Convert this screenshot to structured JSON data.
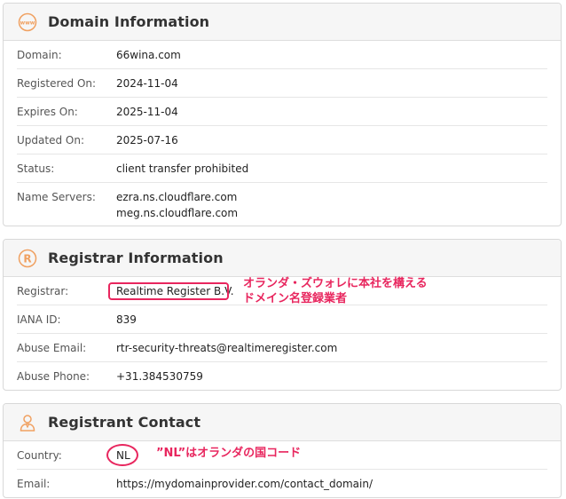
{
  "domain_info": {
    "title": "Domain Information",
    "rows": [
      {
        "label": "Domain:",
        "value": "66wina.com"
      },
      {
        "label": "Registered On:",
        "value": "2024-11-04"
      },
      {
        "label": "Expires On:",
        "value": "2025-11-04"
      },
      {
        "label": "Updated On:",
        "value": "2025-07-16"
      },
      {
        "label": "Status:",
        "value": "client transfer prohibited"
      },
      {
        "label": "Name Servers:",
        "value": "ezra.ns.cloudflare.com",
        "value2": "meg.ns.cloudflare.com"
      }
    ]
  },
  "registrar_info": {
    "title": "Registrar Information",
    "rows": [
      {
        "label": "Registrar:",
        "value": "Realtime Register B.V."
      },
      {
        "label": "IANA ID:",
        "value": "839"
      },
      {
        "label": "Abuse Email:",
        "value": "rtr-security-threats@realtimeregister.com"
      },
      {
        "label": "Abuse Phone:",
        "value": "+31.384530759"
      }
    ],
    "annotation_line1": "オランダ・ズウォレに本社を構える",
    "annotation_line2": "ドメイン名登録業者"
  },
  "registrant_contact": {
    "title": "Registrant Contact",
    "rows": [
      {
        "label": "Country:",
        "value": "NL"
      },
      {
        "label": "Email:",
        "value": "https://mydomainprovider.com/contact_domain/"
      }
    ],
    "annotation": "”NL”はオランダの国コード"
  },
  "colors": {
    "accent": "#e8265e",
    "icon": "#f0a060"
  },
  "icons": [
    "www-icon",
    "registered-icon",
    "person-icon"
  ]
}
